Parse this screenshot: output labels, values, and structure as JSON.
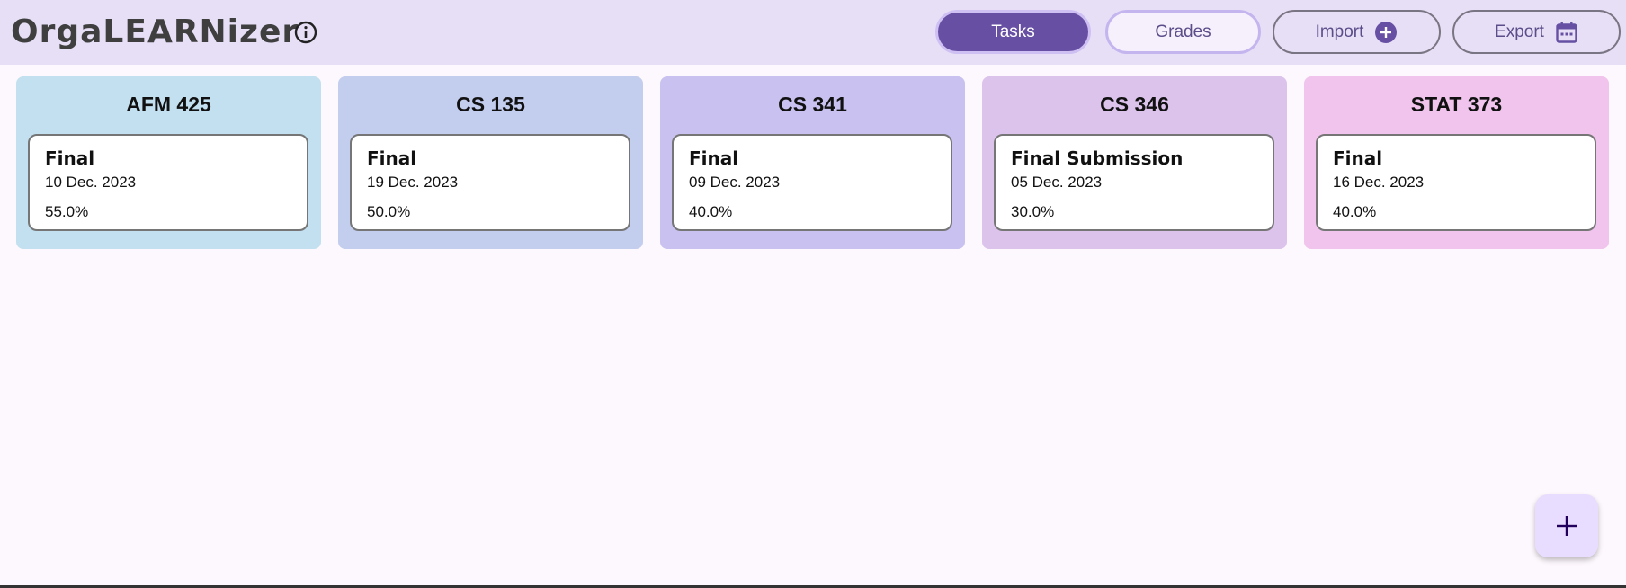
{
  "app": {
    "title": "OrgaLEARNizer",
    "info_icon": "info-circle-icon"
  },
  "nav": {
    "tasks_label": "Tasks",
    "grades_label": "Grades",
    "import_label": "Import",
    "import_icon": "add-circle-icon",
    "export_label": "Export",
    "export_icon": "calendar-icon",
    "active_tab": "Tasks"
  },
  "colors": {
    "accent": "#6750a4",
    "header_bg": "#e7dff6",
    "page_bg": "#fdf8fd"
  },
  "courses": [
    {
      "name": "AFM 425",
      "color": "#c2e0ef",
      "task": {
        "name": "Final",
        "date": "10 Dec. 2023",
        "weight": "55.0%"
      }
    },
    {
      "name": "CS 135",
      "color": "#c3cdee",
      "task": {
        "name": "Final",
        "date": "19 Dec. 2023",
        "weight": "50.0%"
      }
    },
    {
      "name": "CS 341",
      "color": "#c9c1ef",
      "task": {
        "name": "Final",
        "date": "09 Dec. 2023",
        "weight": "40.0%"
      }
    },
    {
      "name": "CS 346",
      "color": "#dcc3ec",
      "task": {
        "name": "Final Submission",
        "date": "05 Dec. 2023",
        "weight": "30.0%"
      }
    },
    {
      "name": "STAT 373",
      "color": "#f0c4ec",
      "task": {
        "name": "Final",
        "date": "16 Dec. 2023",
        "weight": "40.0%"
      }
    }
  ],
  "fab": {
    "icon": "plus-icon"
  }
}
